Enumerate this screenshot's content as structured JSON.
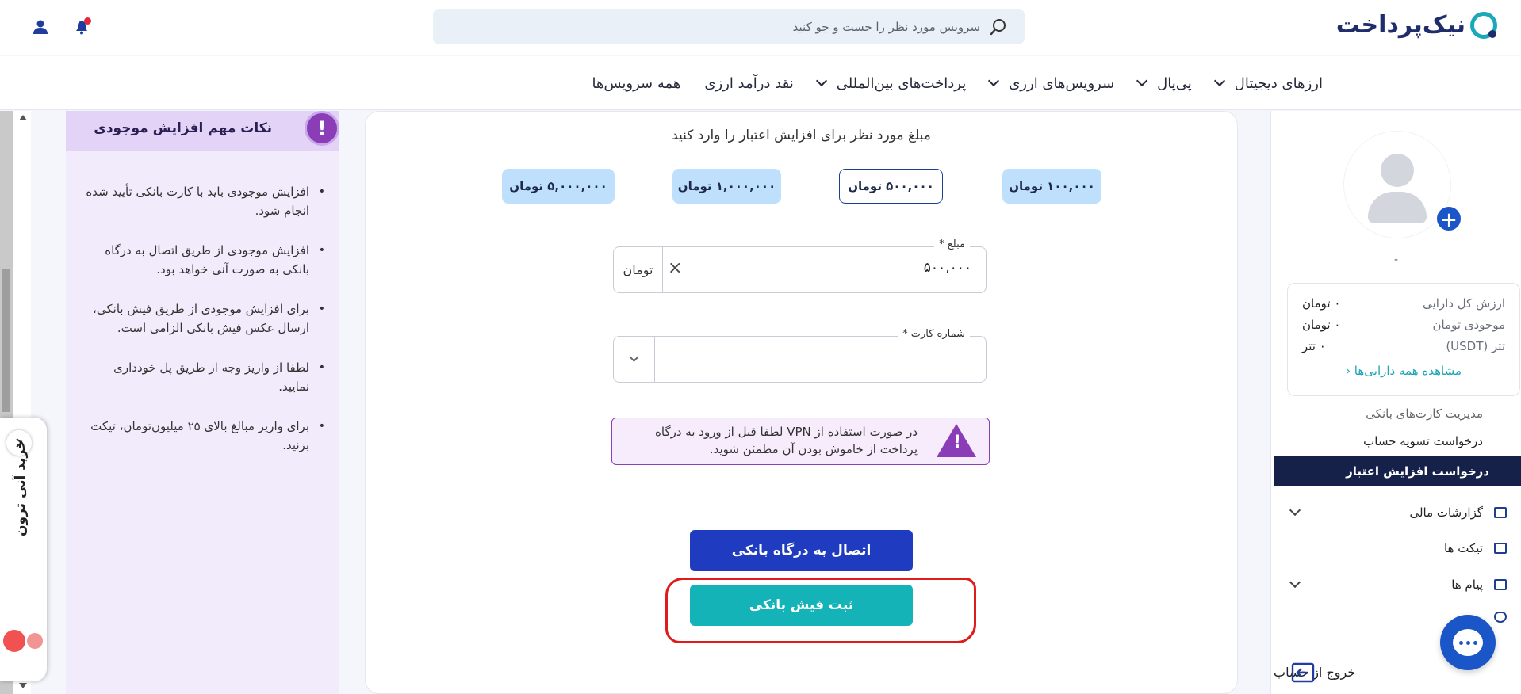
{
  "header": {
    "logo_text": "نیک‌پرداخت",
    "search_placeholder": "سرویس مورد نظر را جست و جو کنید"
  },
  "nav": {
    "items": [
      {
        "label": "ارزهای دیجیتال"
      },
      {
        "label": "پی‌پال"
      },
      {
        "label": "سرویس‌های ارزی"
      },
      {
        "label": "پرداخت‌های بین‌المللی"
      },
      {
        "label": "نقد درآمد ارزی"
      },
      {
        "label": "همه سرویس‌ها"
      }
    ]
  },
  "sidebar": {
    "username": "-",
    "assets": [
      {
        "label": "ارزش کل دارایی",
        "value": "۰ تومان"
      },
      {
        "label": "موجودی تومان",
        "value": "۰ تومان"
      },
      {
        "label": "تتر (USDT)",
        "value": "۰ تتر"
      }
    ],
    "assets_link": "مشاهده همه دارایی‌ها",
    "menu": [
      {
        "label": "مدیریت کارت‌های بانکی"
      },
      {
        "label": "درخواست تسویه حساب"
      },
      {
        "label": "درخواست افزایش اعتبار"
      },
      {
        "label": "گزارشات مالی"
      },
      {
        "label": "تیکت ها"
      },
      {
        "label": "پیام ها"
      }
    ],
    "logout_label": "خروج از حساب"
  },
  "main": {
    "title": "مبلغ مورد نظر برای افزایش اعتبار را وارد کنید",
    "presets": [
      {
        "label": "۱۰۰,۰۰۰ تومان",
        "selected": false
      },
      {
        "label": "۵۰۰,۰۰۰ تومان",
        "selected": true
      },
      {
        "label": "۱,۰۰۰,۰۰۰ تومان",
        "selected": false
      },
      {
        "label": "۵,۰۰۰,۰۰۰ تومان",
        "selected": false
      }
    ],
    "amount_label": "مبلغ *",
    "amount_value": "۵۰۰,۰۰۰",
    "amount_unit": "تومان",
    "card_label": "شماره کارت *",
    "card_value": "",
    "vpn_notice": "در صورت استفاده از VPN لطفا قبل از ورود به درگاه پرداخت از خاموش بودن آن مطمئن شوید.",
    "btn_gateway": "اتصال به درگاه بانکی",
    "btn_receipt": "ثبت فیش بانکی"
  },
  "tips": {
    "title": "نکات مهم افزایش موجودی",
    "items": [
      "افزایش موجودی باید با کارت بانکی تأیید شده انجام شود.",
      "افزایش موجودی از طریق اتصال به درگاه بانکی به صورت آنی خواهد بود.",
      "برای افزایش موجودی از طریق فیش بانکی، ارسال عکس فیش بانکی الزامی است.",
      "لطفا از واریز وجه از طریق پل خودداری نمایید.",
      "برای واریز مبالغ بالای ۲۵ میلیون‌تومان، تیکت بزنید."
    ]
  },
  "side_widget": {
    "label": "خرید آنی ترون"
  },
  "colors": {
    "brand_navy": "#16214a",
    "brand_teal": "#14b3b8",
    "primary_blue": "#1f3cc0",
    "notice_purple": "#8a3db6",
    "highlight_red": "#e01b1b"
  }
}
